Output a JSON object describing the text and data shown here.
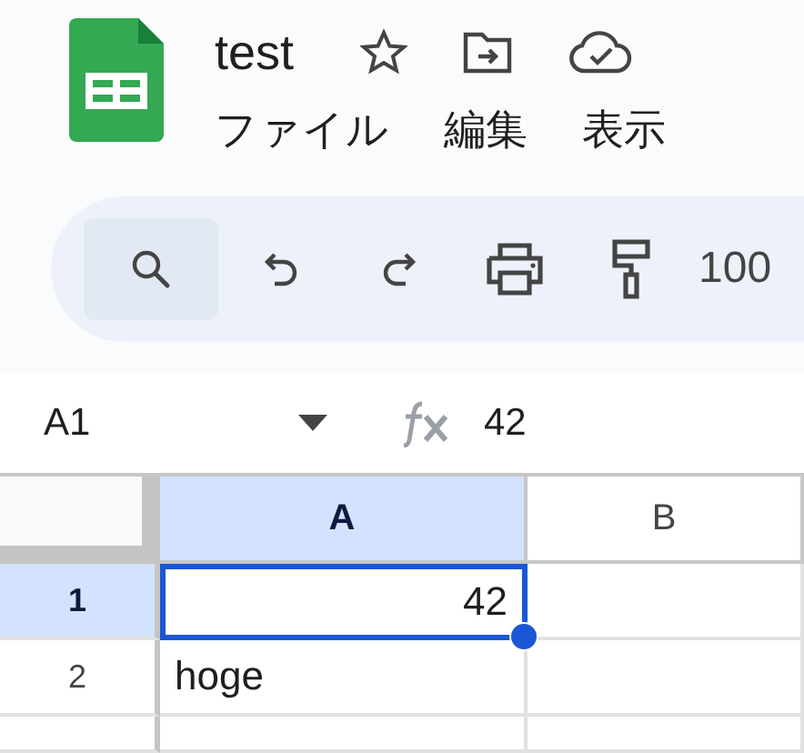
{
  "document": {
    "title": "test"
  },
  "menu": [
    "ファイル",
    "編集",
    "表示"
  ],
  "toolbar": {
    "buttons": [
      {
        "kind": "search",
        "selected": true
      },
      {
        "kind": "undo",
        "selected": false
      },
      {
        "kind": "redo",
        "selected": false
      },
      {
        "kind": "print",
        "selected": false
      },
      {
        "kind": "paint-format",
        "selected": false
      }
    ],
    "zoom": "100"
  },
  "formula_bar": {
    "cell_ref": "A1",
    "formula": "42"
  },
  "grid": {
    "columns": [
      {
        "label": "A",
        "selected": true
      },
      {
        "label": "B",
        "selected": false
      }
    ],
    "rows": [
      {
        "label": "1",
        "selected": true,
        "cells": [
          {
            "value": "42",
            "kind": "number",
            "selected": true
          }
        ]
      },
      {
        "label": "2",
        "selected": false,
        "cells": [
          {
            "value": "hoge",
            "kind": "text",
            "selected": false
          }
        ]
      }
    ]
  }
}
